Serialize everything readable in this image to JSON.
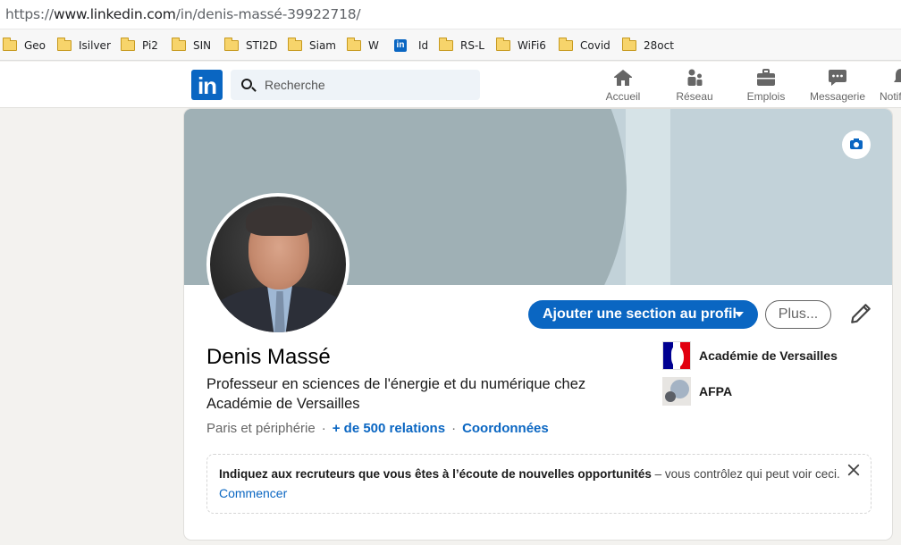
{
  "browser": {
    "url_prefix": "https://",
    "url_host": "www.linkedin.com",
    "url_path": "/in/denis-massé-39922718/"
  },
  "bookmarks": [
    {
      "label": "Geo",
      "icon": "folder-icon"
    },
    {
      "label": "Isilver",
      "icon": "folder-icon"
    },
    {
      "label": "Pi2",
      "icon": "folder-icon"
    },
    {
      "label": "SIN",
      "icon": "folder-icon"
    },
    {
      "label": "STI2D",
      "icon": "folder-icon"
    },
    {
      "label": "Siam",
      "icon": "folder-icon"
    },
    {
      "label": "W",
      "icon": "folder-icon"
    },
    {
      "label": "Id",
      "icon": "linkedin-icon"
    },
    {
      "label": "RS-L",
      "icon": "folder-icon"
    },
    {
      "label": "WiFi6",
      "icon": "folder-icon"
    },
    {
      "label": "Covid",
      "icon": "folder-icon"
    },
    {
      "label": "28oct",
      "icon": "folder-icon"
    }
  ],
  "header": {
    "logo_text": "in",
    "search_placeholder": "Recherche",
    "nav": [
      {
        "label": "Accueil",
        "icon": "home-icon"
      },
      {
        "label": "Réseau",
        "icon": "network-icon"
      },
      {
        "label": "Emplois",
        "icon": "briefcase-icon"
      },
      {
        "label": "Messagerie",
        "icon": "messaging-icon"
      },
      {
        "label": "Notifications",
        "icon": "bell-icon"
      }
    ]
  },
  "profile": {
    "name": "Denis Massé",
    "headline": "Professeur en sciences de l'énergie et du numérique chez Académie de Versailles",
    "location": "Paris et périphérie",
    "relations": "+ de 500 relations",
    "contact": "Coordonnées",
    "add_section_button": "Ajouter une section au profil",
    "more_button": "Plus...",
    "organizations": [
      {
        "name": "Académie de Versailles",
        "icon": "marianne-logo"
      },
      {
        "name": "AFPA",
        "icon": "afpa-logo"
      }
    ]
  },
  "open_to_work_banner": {
    "bold_text": "Indiquez aux recruteurs que vous êtes à l’écoute de nouvelles opportunités",
    "rest_text": " – vous contrôlez qui peut voir ceci.",
    "link": "Commencer"
  },
  "colors": {
    "brand_blue": "#0a66c2",
    "cover_light": "#c2d2d9",
    "cover_arc": "#9fb0b5",
    "page_bg": "#f3f2ef"
  }
}
